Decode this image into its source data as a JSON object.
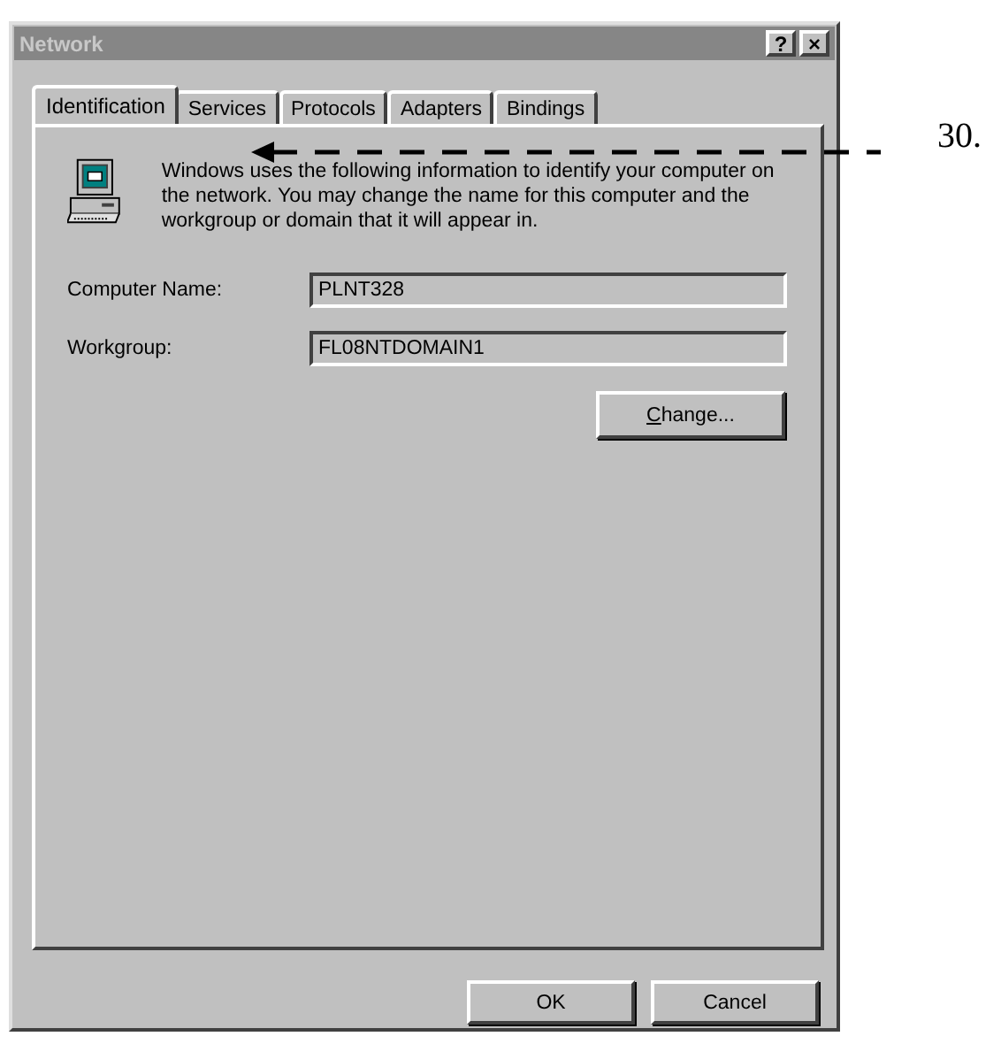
{
  "window": {
    "title": "Network",
    "title_buttons": [
      "?",
      "×"
    ]
  },
  "tabs": [
    {
      "label": "Identification",
      "selected": true
    },
    {
      "label": "Services",
      "selected": false
    },
    {
      "label": "Protocols",
      "selected": false
    },
    {
      "label": "Adapters",
      "selected": false
    },
    {
      "label": "Bindings",
      "selected": false
    }
  ],
  "description": "Windows uses the following information to identify your computer on the network.  You may change the name for this computer and the workgroup or domain that it will appear in.",
  "fields": [
    {
      "label": "Computer Name:",
      "value": "PLNT328"
    },
    {
      "label": "Workgroup:",
      "value": "FL08NTDOMAIN1"
    }
  ],
  "change_button": "Change...",
  "buttons": [
    "OK",
    "Cancel"
  ],
  "callout": {
    "label": "30."
  }
}
